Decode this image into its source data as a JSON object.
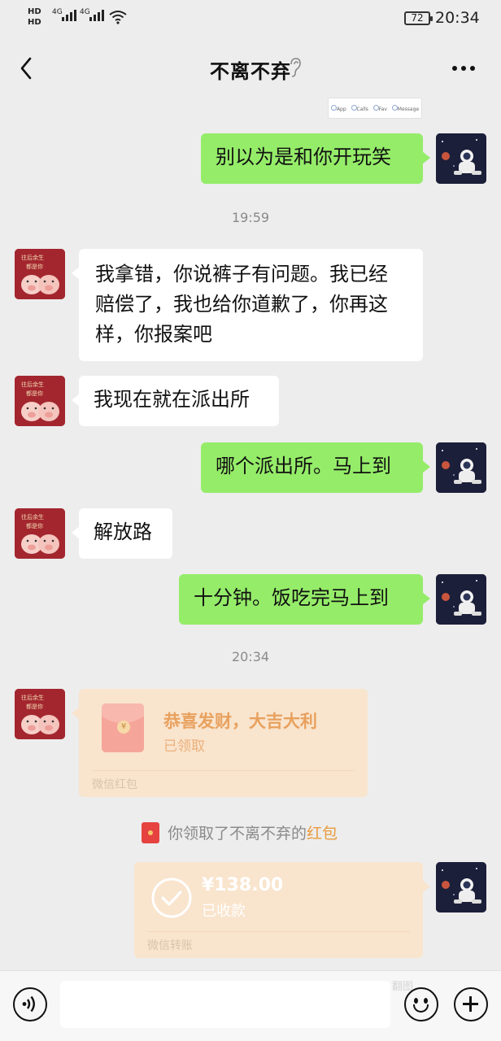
{
  "status_bar": {
    "hd1": "HD",
    "hd2": "HD",
    "sig1": "4G",
    "sig2": "4G",
    "battery": "72",
    "time": "20:34"
  },
  "header": {
    "title": "不离不弃"
  },
  "snippet": {
    "items": [
      "App",
      "Calls",
      "Fav",
      "Message"
    ]
  },
  "messages": {
    "m1": "别以为是和你开玩笑",
    "ts1": "19:59",
    "m2": "我拿错，你说裤子有问题。我已经赔偿了，我也给你道歉了，你再这样，你报案吧",
    "m3": "我现在就在派出所",
    "m4": "哪个派出所。马上到",
    "m5": "解放路",
    "m6": "十分钟。饭吃完马上到",
    "ts2": "20:34"
  },
  "red_packet": {
    "title": "恭喜发财，大吉大利",
    "status": "已领取",
    "footer": "微信红包"
  },
  "notice": {
    "prefix": "你领取了不离不弃的",
    "link": "红包"
  },
  "transfer": {
    "amount": "¥138.00",
    "status": "已收款",
    "footer": "微信转账"
  },
  "watermark": "翻图",
  "colors": {
    "sent_bubble": "#95ec69",
    "received_bubble": "#ffffff",
    "card": "#f9e4cd",
    "link": "#e99a3c",
    "background": "#ededed"
  },
  "icons": {
    "back": "chevron-left-icon",
    "ear": "earpiece-icon",
    "more": "more-dots-icon",
    "voice": "voice-icon",
    "emoji": "emoji-icon",
    "plus": "plus-icon"
  }
}
